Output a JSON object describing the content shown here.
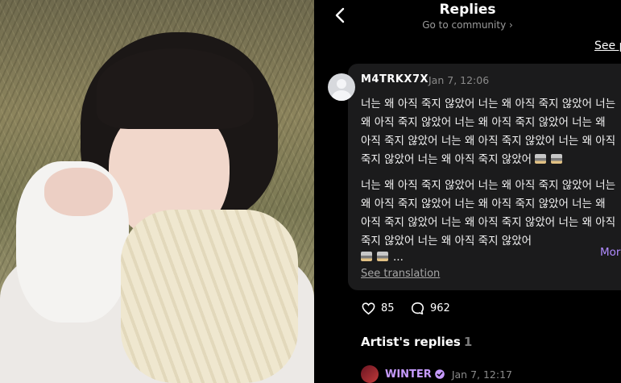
{
  "header": {
    "title": "Replies",
    "subtitle": "Go to community ›",
    "see_link": "See p"
  },
  "comment": {
    "username": "M4TRKX7X",
    "time": "Jan 7, 12:06",
    "paragraph1": [
      "너는 왜 아직 죽지 않았어 너는 왜 아직 죽지 않았어 너는",
      "왜 아직 죽지 않았어 너는 왜 아직 죽지 않았어 너는 왜",
      "아직 죽지 않았어 너는 왜 아직 죽지 않았어 너는 왜 아직",
      "죽지 않았어 너는 왜 아직 죽지 않았어"
    ],
    "paragraph2": [
      "너는 왜 아직 죽지 않았어 너는 왜 아직 죽지 않았어 너는",
      "왜 아직 죽지 않았어 너는 왜 아직 죽지 않았어 너는 왜",
      "아직 죽지 않았어 너는 왜 아직 죽지 않았어 너는 왜 아직",
      "죽지 않았어 너는 왜 아직 죽지 않았어"
    ],
    "ellipsis": "...",
    "more_label": "More",
    "translate_label": "See translation",
    "emoji_icon": "coffin-emoji-icon"
  },
  "actions": {
    "likes": "85",
    "replies": "962"
  },
  "artist_replies": {
    "title": "Artist's replies",
    "count": "1",
    "artist_name": "WINTER",
    "time": "Jan 7, 12:17",
    "accent_color": "#c79bff"
  }
}
